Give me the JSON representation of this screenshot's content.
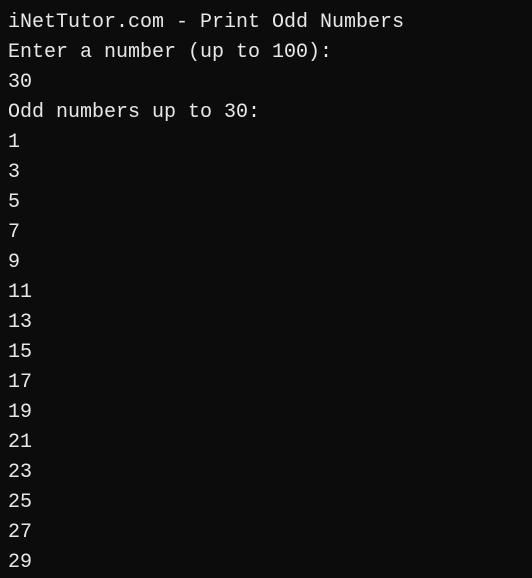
{
  "title": "iNetTutor.com - Print Odd Numbers",
  "prompt": "Enter a number (up to 100):",
  "input_value": "30",
  "result_header": "Odd numbers up to 30:",
  "odd_numbers": [
    "1",
    "3",
    "5",
    "7",
    "9",
    "11",
    "13",
    "15",
    "17",
    "19",
    "21",
    "23",
    "25",
    "27",
    "29"
  ]
}
